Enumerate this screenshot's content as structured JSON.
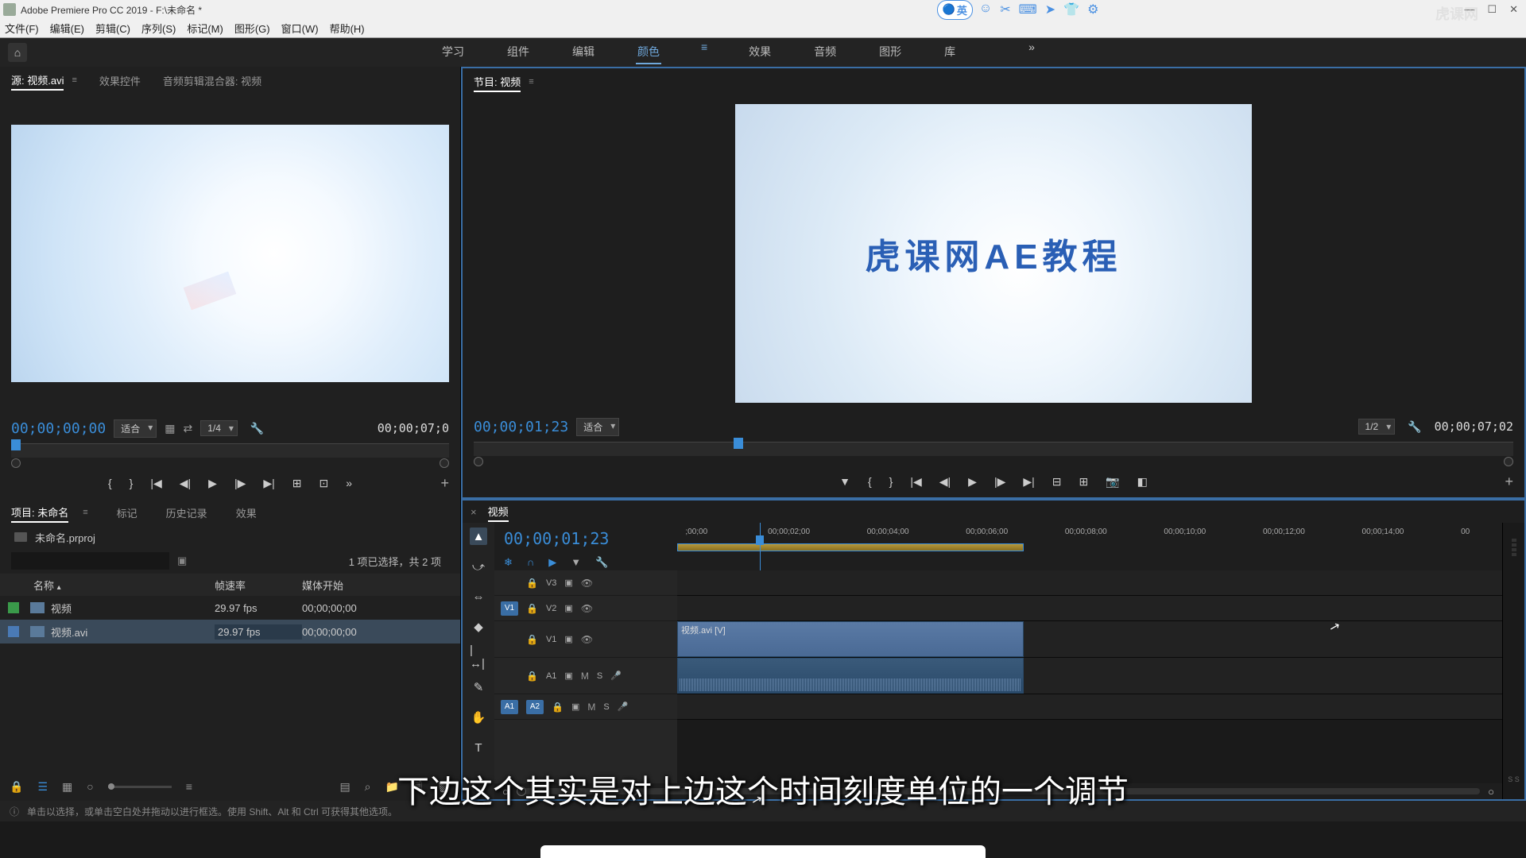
{
  "title": "Adobe Premiere Pro CC 2019 - F:\\未命名 *",
  "q_btn": "英",
  "watermark": "虎课网",
  "menu": {
    "file": "文件(F)",
    "edit": "编辑(E)",
    "clip": "剪辑(C)",
    "sequence": "序列(S)",
    "marker": "标记(M)",
    "graphic": "图形(G)",
    "window": "窗口(W)",
    "help": "帮助(H)"
  },
  "workspaces": {
    "learn": "学习",
    "assembly": "组件",
    "edit": "编辑",
    "color": "颜色",
    "effects": "效果",
    "audio": "音频",
    "graphics": "图形",
    "library": "库"
  },
  "source": {
    "tab": "源: 视频.avi",
    "effects_tab": "效果控件",
    "mixer_tab": "音频剪辑混合器: 视频",
    "tc": "00;00;00;00",
    "fit": "适合",
    "res": "1/4",
    "end": "00;00;07;0"
  },
  "program": {
    "tab": "节目: 视频",
    "text": "虎课网AE教程",
    "tc": "00;00;01;23",
    "fit": "适合",
    "res": "1/2",
    "end": "00;00;07;02"
  },
  "project": {
    "tab": "项目: 未命名",
    "marker": "标记",
    "history": "历史记录",
    "effects": "效果",
    "name": "未命名.prproj",
    "sel_info": "1 项已选择，共 2 项",
    "col_name": "名称",
    "col_fps": "帧速率",
    "col_start": "媒体开始",
    "items": [
      {
        "name": "视频",
        "fps": "29.97 fps",
        "start": "00;00;00;00",
        "sel": false
      },
      {
        "name": "视频.avi",
        "fps": "29.97 fps",
        "start": "00;00;00;00",
        "sel": true
      }
    ]
  },
  "timeline": {
    "tab": "视频",
    "tc": "00;00;01;23",
    "clip_name": "视频.avi [V]",
    "ticks": [
      ";00;00",
      "00;00;02;00",
      "00;00;04;00",
      "00;00;06;00",
      "00;00;08;00",
      "00;00;10;00",
      "00;00;12;00",
      "00;00;14;00",
      "00"
    ],
    "tracks": {
      "v3": "V3",
      "v2": "V2",
      "v1": "V1",
      "a1": "A1",
      "a2": "A2"
    }
  },
  "status": "单击以选择，或单击空白处并拖动以进行框选。使用 Shift、Alt 和 Ctrl 可获得其他选项。",
  "subtitle": "下边这个其实是对上边这个时间刻度单位的一个调节"
}
